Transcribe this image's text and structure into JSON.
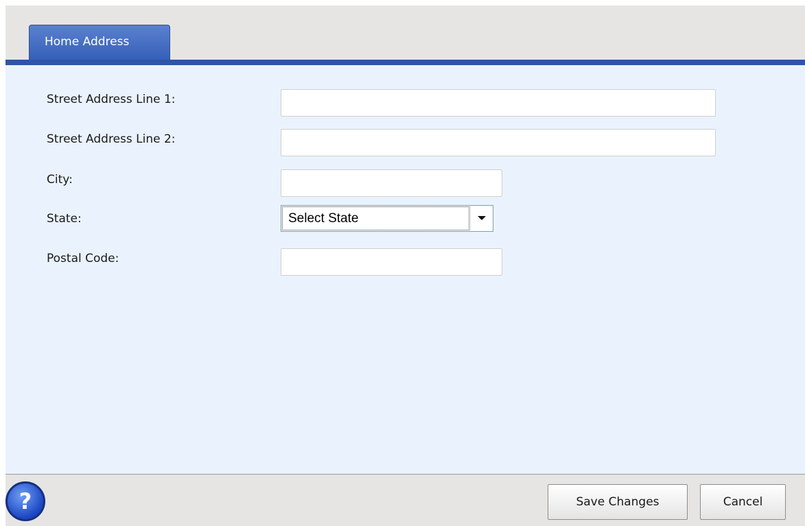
{
  "tabs": [
    {
      "label": "Home Address",
      "active": true
    }
  ],
  "form": {
    "street1": {
      "label": "Street Address Line 1:",
      "value": ""
    },
    "street2": {
      "label": "Street Address Line 2:",
      "value": ""
    },
    "city": {
      "label": "City:",
      "value": ""
    },
    "state": {
      "label": "State:",
      "selected": "Select State"
    },
    "postal": {
      "label": "Postal Code:",
      "value": ""
    }
  },
  "footer": {
    "help_glyph": "?",
    "help_icon": "help-question-icon",
    "save_label": "Save Changes",
    "cancel_label": "Cancel"
  },
  "colors": {
    "accent": "#2f54a8",
    "content_bg": "#eaf3fd",
    "chrome_bg": "#e6e5e3"
  }
}
